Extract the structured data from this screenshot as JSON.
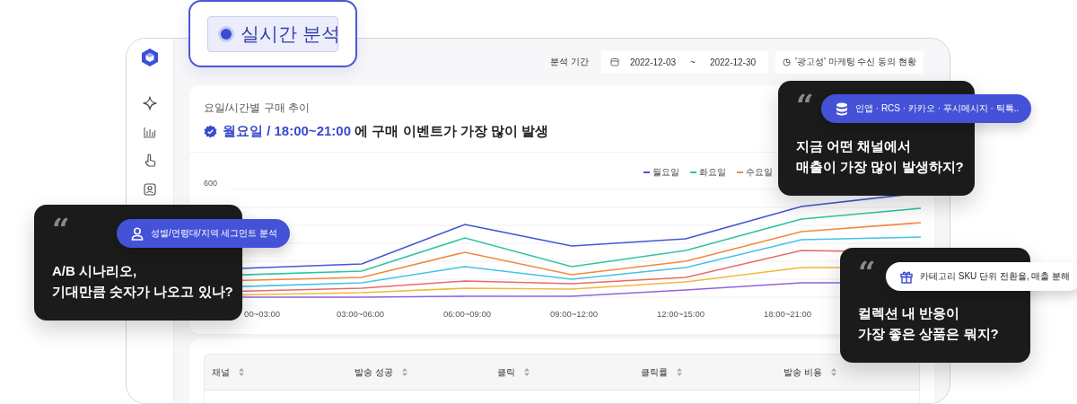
{
  "badge": {
    "label": "실시간 분석"
  },
  "header": {
    "period_label": "분석 기간",
    "start_date": "2022-12-03",
    "separator": "~",
    "end_date": "2022-12-30",
    "consent_button": "'광고성' 마케팅 수신 동의 현황"
  },
  "chart_card": {
    "subtitle": "요일/시간별 구매 추이",
    "headline_highlight": "월요일 / 18:00~21:00",
    "headline_rest": "에 구매 이벤트가 가장 많이 발생",
    "legend": [
      {
        "label": "월요일",
        "color": "#4456d6"
      },
      {
        "label": "화요일",
        "color": "#2ec4a0"
      },
      {
        "label": "수요일",
        "color": "#f08a3c"
      }
    ],
    "y_tick": "600",
    "x_labels": [
      "00~03:00",
      "03:00~06:00",
      "06:00~09:00",
      "09:00~12:00",
      "12:00~15:00",
      "18:00~21:00"
    ]
  },
  "table": {
    "columns": [
      "채널",
      "발송 성공",
      "클릭",
      "클릭률",
      "발송 비용"
    ]
  },
  "quote_cards": [
    {
      "mark": "“",
      "pill": {
        "kind": "primary",
        "label": "인앱 · RCS · 카카오 · 푸시메시지 · 틱톡.."
      },
      "question": "지금 어떤 채널에서\n매출이 가장 많이 발생하지?"
    },
    {
      "mark": "“",
      "pill": {
        "kind": "primary",
        "label": "성별/연령대/지역 세그먼트 분석"
      },
      "question": "A/B 시나리오,\n기대만큼 숫자가 나오고 있나?"
    },
    {
      "mark": "“",
      "pill": {
        "kind": "light",
        "label": "카테고리 SKU 단위 전환율, 매출 분해"
      },
      "question": "컬렉션 내 반응이\n가장 좋은 상품은 뭐지?"
    }
  ]
}
